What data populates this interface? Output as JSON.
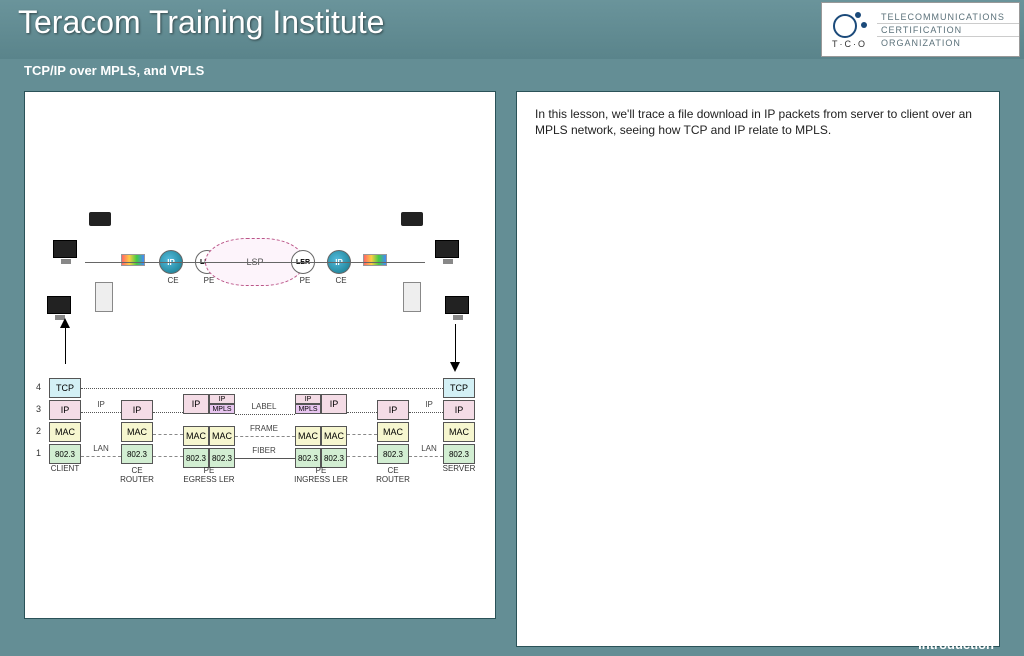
{
  "header": {
    "title": "Teracom Training Institute"
  },
  "tco": {
    "abbr": "T·C·O",
    "lines": [
      "TELECOMMUNICATIONS",
      "CERTIFICATION",
      "ORGANIZATION"
    ]
  },
  "subtitle": "TCP/IP over MPLS, and VPLS",
  "lesson_text": "In this lesson, we'll trace a file download in IP packets from server to client over an MPLS network, seeing how TCP and IP relate to MPLS.",
  "footer": "Introduction",
  "diagram": {
    "top_nodes": {
      "ce_left": "CE",
      "pe_left": "PE",
      "lsp": "LSP",
      "pe_right": "PE",
      "ce_right": "CE",
      "ip_label": "IP",
      "ler_label": "LER"
    },
    "row_numbers": [
      "4",
      "3",
      "2",
      "1"
    ],
    "layers": {
      "tcp": "TCP",
      "ip": "IP",
      "mpls": "MPLS",
      "mac": "MAC",
      "l802": "802.3"
    },
    "stack_labels": {
      "client": "CLIENT",
      "ce_router": "CE\nROUTER",
      "pe_egress": "PE\nEGRESS LER",
      "pe_ingress": "PE\nINGRESS LER",
      "ce_router_r": "CE\nROUTER",
      "server": "SERVER"
    },
    "link_labels": {
      "ip": "IP",
      "lan": "LAN",
      "label": "LABEL",
      "frame": "FRAME",
      "fiber": "FIBER"
    }
  }
}
